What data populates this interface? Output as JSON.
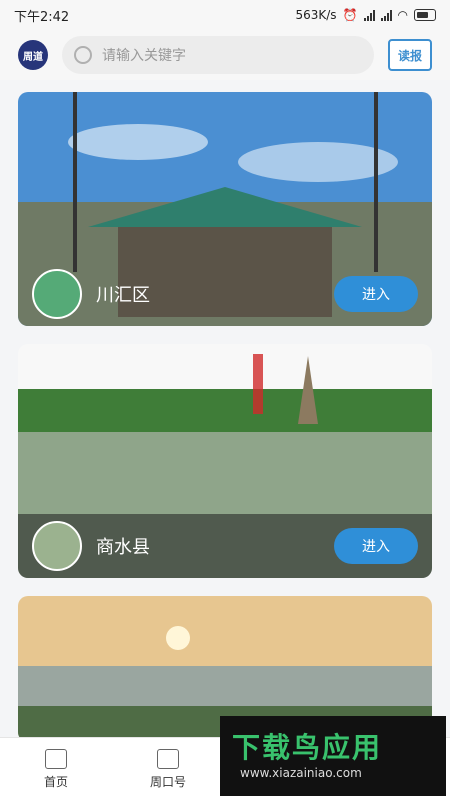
{
  "status": {
    "time": "下午2:42",
    "speed": "563K/s"
  },
  "header": {
    "logo_text": "周道",
    "search_placeholder": "请输入关键字",
    "reader_label": "读报"
  },
  "cards": [
    {
      "name": "川汇区",
      "button": "进入"
    },
    {
      "name": "商水县",
      "button": "进入"
    },
    {
      "name": "",
      "button": ""
    }
  ],
  "tabs": [
    {
      "label": "首页"
    },
    {
      "label": "周口号"
    }
  ],
  "watermark": {
    "main": "下载鸟应用",
    "sub": "www.xiazainiao.com"
  }
}
